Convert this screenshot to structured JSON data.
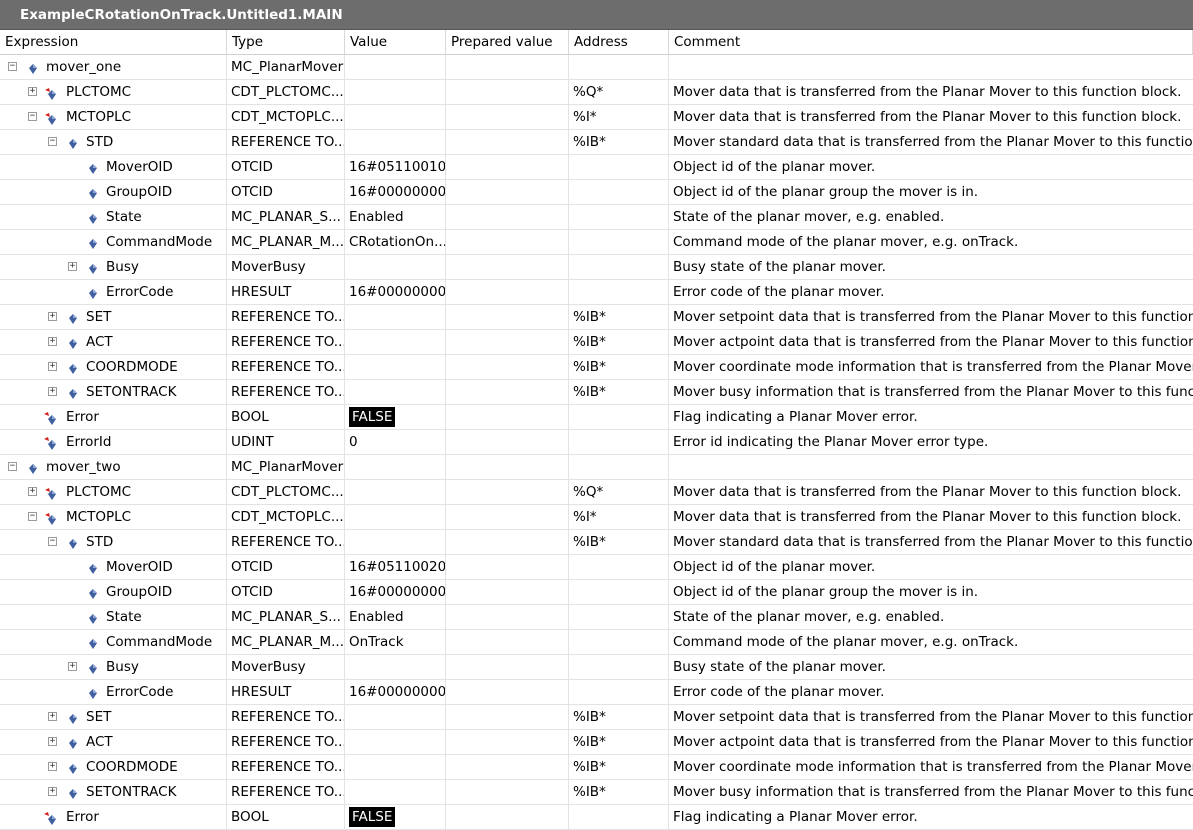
{
  "window": {
    "title": "ExampleCRotationOnTrack.Untitled1.MAIN"
  },
  "columns": [
    "Expression",
    "Type",
    "Value",
    "Prepared value",
    "Address",
    "Comment"
  ],
  "rows": [
    {
      "level": 0,
      "toggle": "-",
      "icon": "variable",
      "expr": "mover_one",
      "type": "MC_PlanarMover",
      "value": "",
      "prepared": "",
      "address": "",
      "comment": ""
    },
    {
      "level": 1,
      "toggle": "+",
      "icon": "output",
      "expr": "PLCTOMC",
      "type": "CDT_PLCTOMC...",
      "value": "",
      "prepared": "",
      "address": "%Q*",
      "comment": "Mover data that is transferred from the Planar Mover to this function block."
    },
    {
      "level": 1,
      "toggle": "-",
      "icon": "output",
      "expr": "MCTOPLC",
      "type": "CDT_MCTOPLC...",
      "value": "",
      "prepared": "",
      "address": "%I*",
      "comment": "Mover data that is transferred from the Planar Mover to this function block."
    },
    {
      "level": 2,
      "toggle": "-",
      "icon": "variable",
      "expr": "STD",
      "type": "REFERENCE TO...",
      "value": "",
      "prepared": "",
      "address": "%IB*",
      "comment": "Mover standard data that is transferred from the Planar Mover to this function b"
    },
    {
      "level": 3,
      "toggle": "",
      "icon": "variable",
      "expr": "MoverOID",
      "type": "OTCID",
      "value": "16#05110010",
      "prepared": "",
      "address": "",
      "comment": "Object id of the planar mover."
    },
    {
      "level": 3,
      "toggle": "",
      "icon": "variable",
      "expr": "GroupOID",
      "type": "OTCID",
      "value": "16#00000000",
      "prepared": "",
      "address": "",
      "comment": "Object id of the planar group the mover is in."
    },
    {
      "level": 3,
      "toggle": "",
      "icon": "variable",
      "expr": "State",
      "type": "MC_PLANAR_S...",
      "value": "Enabled",
      "prepared": "",
      "address": "",
      "comment": "State of the planar mover, e.g. enabled."
    },
    {
      "level": 3,
      "toggle": "",
      "icon": "variable",
      "expr": "CommandMode",
      "type": "MC_PLANAR_M...",
      "value": "CRotationOn...",
      "prepared": "",
      "address": "",
      "comment": "Command mode of the planar mover, e.g. onTrack."
    },
    {
      "level": 3,
      "toggle": "+",
      "icon": "variable",
      "expr": "Busy",
      "type": "MoverBusy",
      "value": "",
      "prepared": "",
      "address": "",
      "comment": "Busy state of the planar mover."
    },
    {
      "level": 3,
      "toggle": "",
      "icon": "variable",
      "expr": "ErrorCode",
      "type": "HRESULT",
      "value": "16#00000000",
      "prepared": "",
      "address": "",
      "comment": "Error code of the planar mover."
    },
    {
      "level": 2,
      "toggle": "+",
      "icon": "variable",
      "expr": "SET",
      "type": "REFERENCE TO...",
      "value": "",
      "prepared": "",
      "address": "%IB*",
      "comment": "Mover setpoint data that is transferred from the Planar Mover to this function b"
    },
    {
      "level": 2,
      "toggle": "+",
      "icon": "variable",
      "expr": "ACT",
      "type": "REFERENCE TO...",
      "value": "",
      "prepared": "",
      "address": "%IB*",
      "comment": "Mover actpoint data that is transferred from the Planar Mover to this function b"
    },
    {
      "level": 2,
      "toggle": "+",
      "icon": "variable",
      "expr": "COORDMODE",
      "type": "REFERENCE TO...",
      "value": "",
      "prepared": "",
      "address": "%IB*",
      "comment": "Mover coordinate mode information that is transferred from the Planar Mover to t"
    },
    {
      "level": 2,
      "toggle": "+",
      "icon": "variable",
      "expr": "SETONTRACK",
      "type": "REFERENCE TO...",
      "value": "",
      "prepared": "",
      "address": "%IB*",
      "comment": "Mover busy information that is transferred from the Planar Mover to this functio"
    },
    {
      "level": 1,
      "toggle": "",
      "icon": "output-small",
      "expr": "Error",
      "type": "BOOL",
      "value": "FALSE",
      "bool": true,
      "prepared": "",
      "address": "",
      "comment": "Flag indicating a Planar Mover error."
    },
    {
      "level": 1,
      "toggle": "",
      "icon": "output-small",
      "expr": "ErrorId",
      "type": "UDINT",
      "value": "0",
      "prepared": "",
      "address": "",
      "comment": "Error id indicating the Planar Mover error type."
    },
    {
      "level": 0,
      "toggle": "-",
      "icon": "variable",
      "expr": "mover_two",
      "type": "MC_PlanarMover",
      "value": "",
      "prepared": "",
      "address": "",
      "comment": ""
    },
    {
      "level": 1,
      "toggle": "+",
      "icon": "output",
      "expr": "PLCTOMC",
      "type": "CDT_PLCTOMC...",
      "value": "",
      "prepared": "",
      "address": "%Q*",
      "comment": "Mover data that is transferred from the Planar Mover to this function block."
    },
    {
      "level": 1,
      "toggle": "-",
      "icon": "output",
      "expr": "MCTOPLC",
      "type": "CDT_MCTOPLC...",
      "value": "",
      "prepared": "",
      "address": "%I*",
      "comment": "Mover data that is transferred from the Planar Mover to this function block."
    },
    {
      "level": 2,
      "toggle": "-",
      "icon": "variable",
      "expr": "STD",
      "type": "REFERENCE TO...",
      "value": "",
      "prepared": "",
      "address": "%IB*",
      "comment": "Mover standard data that is transferred from the Planar Mover to this function b"
    },
    {
      "level": 3,
      "toggle": "",
      "icon": "variable",
      "expr": "MoverOID",
      "type": "OTCID",
      "value": "16#05110020",
      "prepared": "",
      "address": "",
      "comment": "Object id of the planar mover."
    },
    {
      "level": 3,
      "toggle": "",
      "icon": "variable",
      "expr": "GroupOID",
      "type": "OTCID",
      "value": "16#00000000",
      "prepared": "",
      "address": "",
      "comment": "Object id of the planar group the mover is in."
    },
    {
      "level": 3,
      "toggle": "",
      "icon": "variable",
      "expr": "State",
      "type": "MC_PLANAR_S...",
      "value": "Enabled",
      "prepared": "",
      "address": "",
      "comment": "State of the planar mover, e.g. enabled."
    },
    {
      "level": 3,
      "toggle": "",
      "icon": "variable",
      "expr": "CommandMode",
      "type": "MC_PLANAR_M...",
      "value": "OnTrack",
      "prepared": "",
      "address": "",
      "comment": "Command mode of the planar mover, e.g. onTrack."
    },
    {
      "level": 3,
      "toggle": "+",
      "icon": "variable",
      "expr": "Busy",
      "type": "MoverBusy",
      "value": "",
      "prepared": "",
      "address": "",
      "comment": "Busy state of the planar mover."
    },
    {
      "level": 3,
      "toggle": "",
      "icon": "variable",
      "expr": "ErrorCode",
      "type": "HRESULT",
      "value": "16#00000000",
      "prepared": "",
      "address": "",
      "comment": "Error code of the planar mover."
    },
    {
      "level": 2,
      "toggle": "+",
      "icon": "variable",
      "expr": "SET",
      "type": "REFERENCE TO...",
      "value": "",
      "prepared": "",
      "address": "%IB*",
      "comment": "Mover setpoint data that is transferred from the Planar Mover to this function b"
    },
    {
      "level": 2,
      "toggle": "+",
      "icon": "variable",
      "expr": "ACT",
      "type": "REFERENCE TO...",
      "value": "",
      "prepared": "",
      "address": "%IB*",
      "comment": "Mover actpoint data that is transferred from the Planar Mover to this function b"
    },
    {
      "level": 2,
      "toggle": "+",
      "icon": "variable",
      "expr": "COORDMODE",
      "type": "REFERENCE TO...",
      "value": "",
      "prepared": "",
      "address": "%IB*",
      "comment": "Mover coordinate mode information that is transferred from the Planar Mover to t"
    },
    {
      "level": 2,
      "toggle": "+",
      "icon": "variable",
      "expr": "SETONTRACK",
      "type": "REFERENCE TO...",
      "value": "",
      "prepared": "",
      "address": "%IB*",
      "comment": "Mover busy information that is transferred from the Planar Mover to this functio"
    },
    {
      "level": 1,
      "toggle": "",
      "icon": "output-small",
      "expr": "Error",
      "type": "BOOL",
      "value": "FALSE",
      "bool": true,
      "prepared": "",
      "address": "",
      "comment": "Flag indicating a Planar Mover error."
    }
  ]
}
